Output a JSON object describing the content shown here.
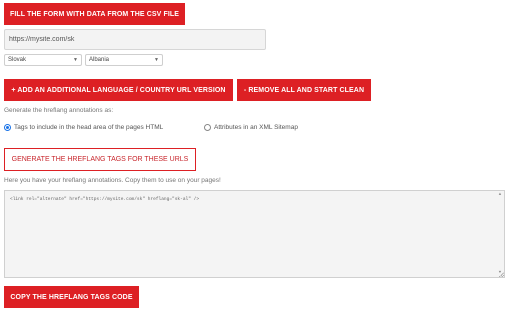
{
  "buttons": {
    "fill_csv": "FILL THE FORM WITH DATA FROM THE CSV FILE",
    "add_language": "+ ADD AN ADDITIONAL LANGUAGE / COUNTRY URL VERSION",
    "remove_all": "- REMOVE ALL AND START CLEAN",
    "generate": "GENERATE THE HREFLANG TAGS FOR THESE URLS",
    "copy": "COPY THE HREFLANG TAGS CODE"
  },
  "url_entry": {
    "url_value": "https://mysite.com/sk",
    "language_selected": "Slovak",
    "country_selected": "Albania"
  },
  "annotations": {
    "prompt": "Generate the hreflang annotations as:",
    "option_head": "Tags to include in the head area of the pages HTML",
    "option_sitemap": "Attributes in an XML Sitemap",
    "selected": "head"
  },
  "output": {
    "intro": "Here you have your hreflang annotations. Copy them to use on your pages!",
    "code": "<link rel=\"alternate\" href=\"https://mysite.com/sk\" hreflang=\"sk-al\" />"
  },
  "colors": {
    "accent": "#dd2024",
    "radio_checked": "#1a73e8"
  }
}
